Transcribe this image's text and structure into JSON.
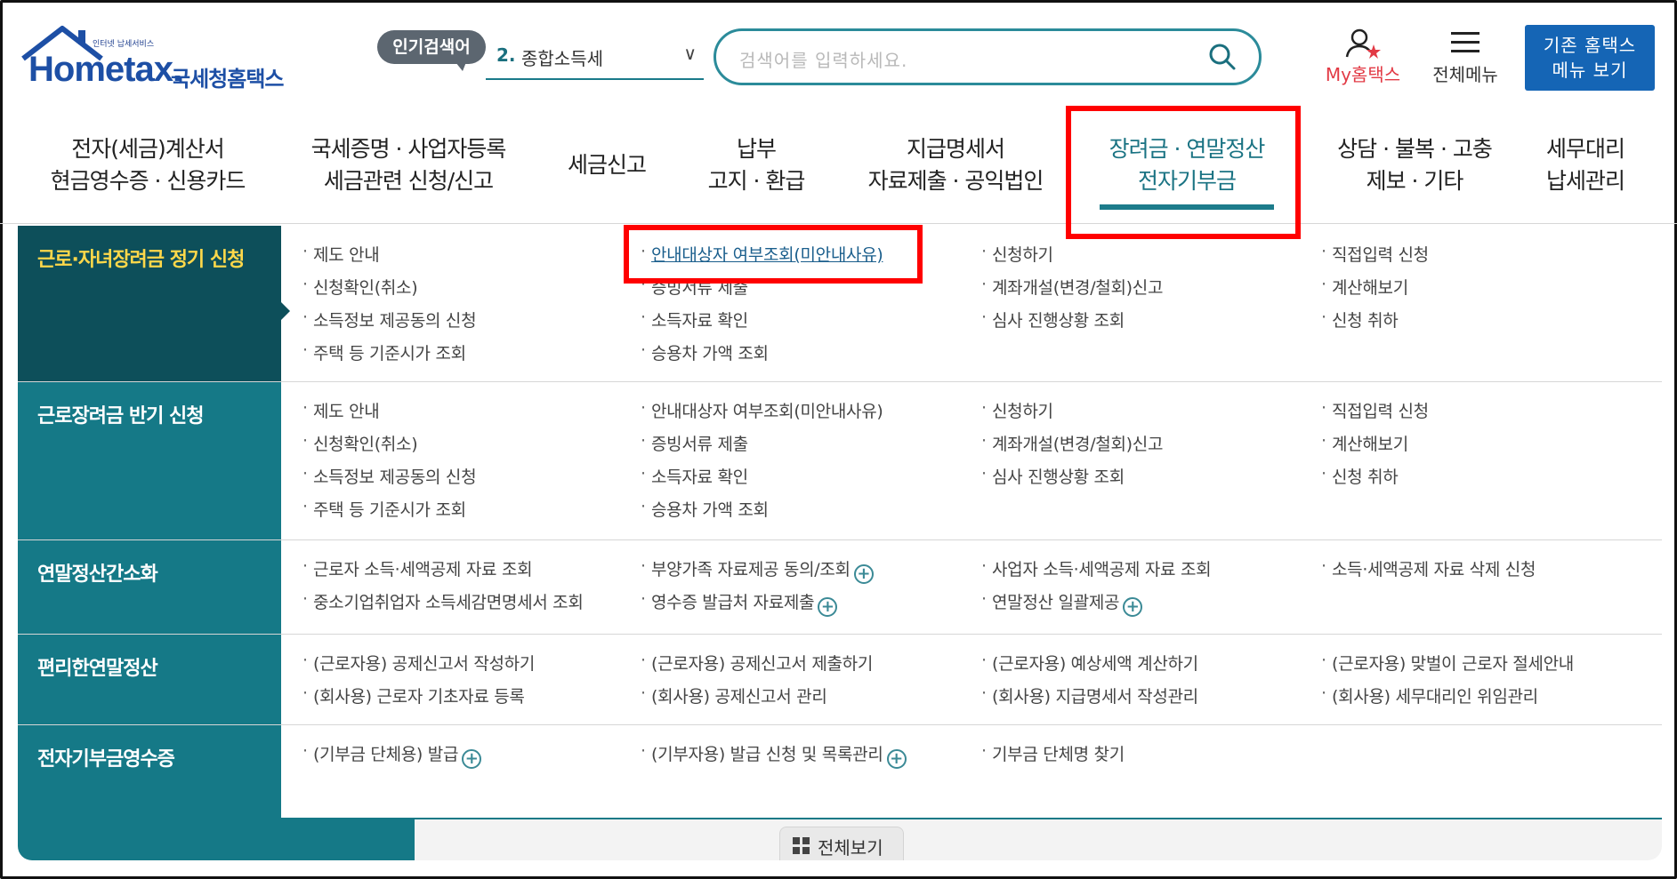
{
  "header": {
    "logo_small": "인터넷 납세서비스",
    "logo_text": "Hometax.",
    "logo_kor": "국세청홈택스",
    "popular_label": "인기검색어",
    "trend_num": "2.",
    "trend_text": "종합소득세",
    "search_placeholder": "검색어를 입력하세요.",
    "my_label": "My홈택스",
    "menu_label": "전체메뉴",
    "legacy_line1": "기존 홈택스",
    "legacy_line2": "메뉴 보기"
  },
  "nav": [
    {
      "l1": "전자(세금)계산서",
      "l2": "현금영수증 · 신용카드"
    },
    {
      "l1": "국세증명 · 사업자등록",
      "l2": "세금관련 신청/신고"
    },
    {
      "l1": "세금신고",
      "l2": ""
    },
    {
      "l1": "납부",
      "l2": "고지 · 환급"
    },
    {
      "l1": "지급명세서",
      "l2": "자료제출 · 공익법인"
    },
    {
      "l1": "장려금 · 연말정산",
      "l2": "전자기부금"
    },
    {
      "l1": "상담 · 불복 · 고충",
      "l2": "제보 · 기타"
    },
    {
      "l1": "세무대리",
      "l2": "납세관리"
    }
  ],
  "sections": [
    {
      "title": "근로·자녀장려금 정기 신청",
      "cols": [
        [
          "제도 안내",
          "신청확인(취소)",
          "소득정보 제공동의 신청",
          "주택 등 기준시가 조회"
        ],
        [
          "안내대상자 여부조회(미안내사유)",
          "증빙서류 제출",
          "소득자료 확인",
          "승용차 가액 조회"
        ],
        [
          "신청하기",
          "계좌개설(변경/철회)신고",
          "심사 진행상황 조회"
        ],
        [
          "직접입력 신청",
          "계산해보기",
          "신청 취하"
        ]
      ]
    },
    {
      "title": "근로장려금 반기 신청",
      "cols": [
        [
          "제도 안내",
          "신청확인(취소)",
          "소득정보 제공동의 신청",
          "주택 등 기준시가 조회"
        ],
        [
          "안내대상자 여부조회(미안내사유)",
          "증빙서류 제출",
          "소득자료 확인",
          "승용차 가액 조회"
        ],
        [
          "신청하기",
          "계좌개설(변경/철회)신고",
          "심사 진행상황 조회"
        ],
        [
          "직접입력 신청",
          "계산해보기",
          "신청 취하"
        ]
      ]
    },
    {
      "title": "연말정산간소화",
      "cols": [
        [
          "근로자 소득·세액공제 자료 조회",
          "중소기업취업자 소득세감면명세서 조회"
        ],
        [
          "부양가족 자료제공 동의/조회",
          "영수증 발급처 자료제출"
        ],
        [
          "사업자 소득·세액공제 자료 조회",
          "연말정산 일괄제공"
        ],
        [
          "소득·세액공제 자료 삭제 신청"
        ]
      ]
    },
    {
      "title": "편리한연말정산",
      "cols": [
        [
          "(근로자용) 공제신고서 작성하기",
          "(회사용) 근로자 기초자료 등록"
        ],
        [
          "(근로자용) 공제신고서 제출하기",
          "(회사용) 공제신고서 관리"
        ],
        [
          "(근로자용) 예상세액 계산하기",
          "(회사용) 지급명세서 작성관리"
        ],
        [
          "(근로자용) 맞벌이 근로자 절세안내",
          "(회사용) 세무대리인 위임관리"
        ]
      ]
    },
    {
      "title": "전자기부금영수증",
      "cols": [
        [
          "(기부금 단체용) 발급"
        ],
        [
          "(기부자용) 발급 신청 및 목록관리"
        ],
        [
          "기부금 단체명 찾기"
        ],
        []
      ]
    }
  ],
  "footer": {
    "view_all": "전체보기"
  }
}
